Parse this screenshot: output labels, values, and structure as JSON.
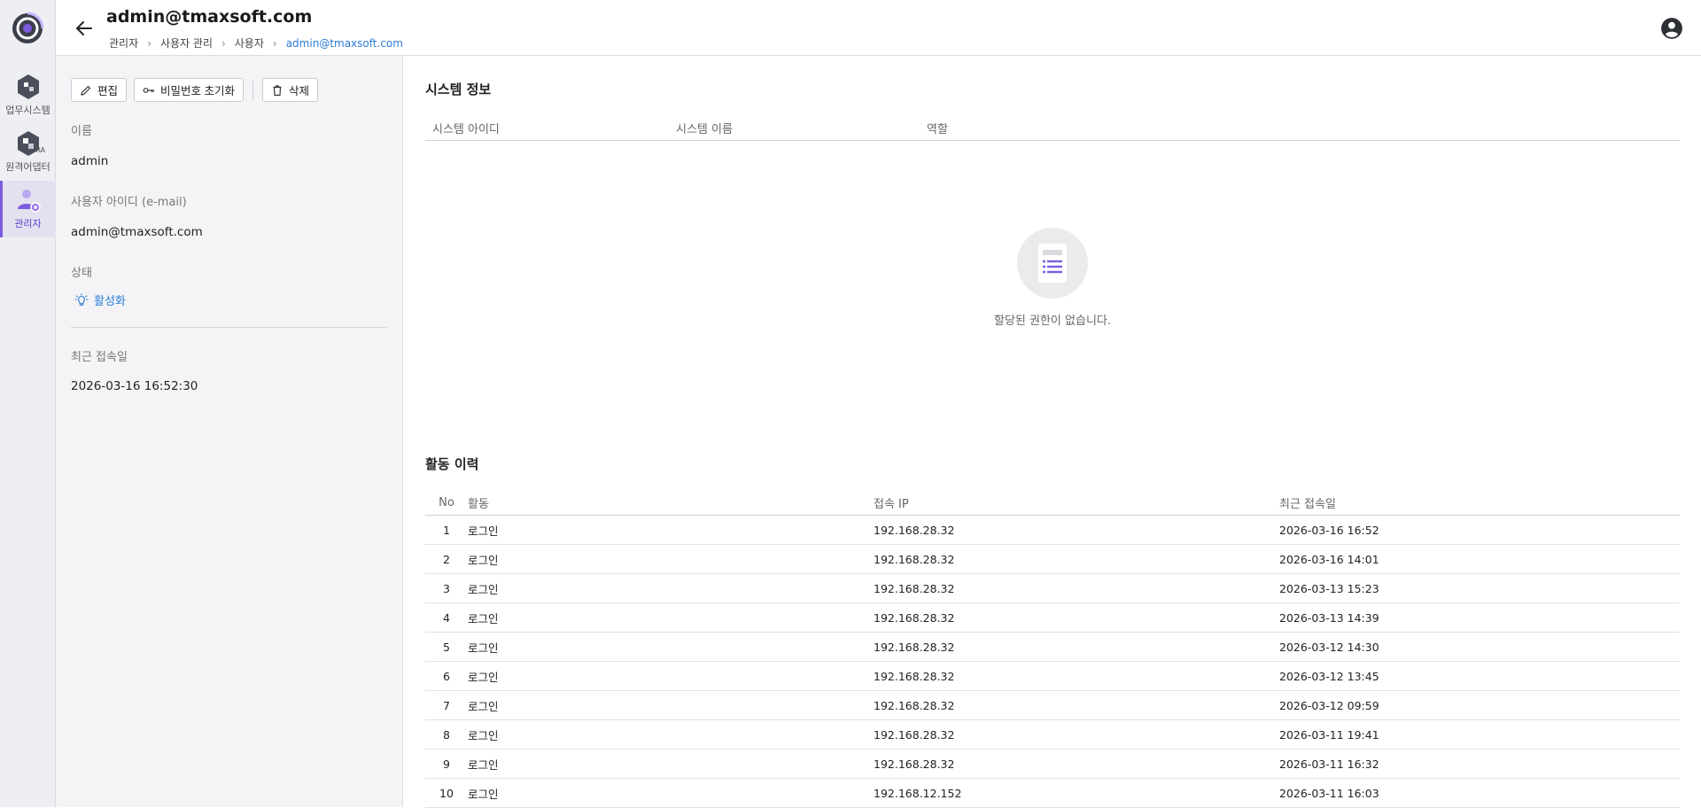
{
  "nav": {
    "items": [
      {
        "label": "업무시스템"
      },
      {
        "label": "원격어댑터",
        "badge": "RA"
      },
      {
        "label": "관리자"
      }
    ]
  },
  "header": {
    "title": "admin@tmaxsoft.com",
    "breadcrumb": [
      "관리자",
      "사용자 관리",
      "사용자",
      "admin@tmaxsoft.com"
    ]
  },
  "toolbar": {
    "edit_label": "편집",
    "reset_password_label": "비밀번호 초기화",
    "delete_label": "삭제"
  },
  "profile": {
    "name_label": "이름",
    "name_value": "admin",
    "id_label": "사용자 아이디 (e-mail)",
    "id_value": "admin@tmaxsoft.com",
    "status_label": "상태",
    "status_value": "활성화",
    "last_login_label": "최근 접속일",
    "last_login_value": "2026-03-16 16:52:30"
  },
  "system_info": {
    "title": "시스템 정보",
    "columns": [
      "시스템 아이디",
      "시스템 이름",
      "역할"
    ],
    "empty_text": "할당된 권한이 없습니다."
  },
  "activity": {
    "title": "활동 이력",
    "columns": [
      "No",
      "활동",
      "접속 IP",
      "최근 접속일"
    ],
    "rows": [
      {
        "no": "1",
        "activity": "로그인",
        "ip": "192.168.28.32",
        "date": "2026-03-16 16:52"
      },
      {
        "no": "2",
        "activity": "로그인",
        "ip": "192.168.28.32",
        "date": "2026-03-16 14:01"
      },
      {
        "no": "3",
        "activity": "로그인",
        "ip": "192.168.28.32",
        "date": "2026-03-13 15:23"
      },
      {
        "no": "4",
        "activity": "로그인",
        "ip": "192.168.28.32",
        "date": "2026-03-13 14:39"
      },
      {
        "no": "5",
        "activity": "로그인",
        "ip": "192.168.28.32",
        "date": "2026-03-12 14:30"
      },
      {
        "no": "6",
        "activity": "로그인",
        "ip": "192.168.28.32",
        "date": "2026-03-12 13:45"
      },
      {
        "no": "7",
        "activity": "로그인",
        "ip": "192.168.28.32",
        "date": "2026-03-12 09:59"
      },
      {
        "no": "8",
        "activity": "로그인",
        "ip": "192.168.28.32",
        "date": "2026-03-11 19:41"
      },
      {
        "no": "9",
        "activity": "로그인",
        "ip": "192.168.28.32",
        "date": "2026-03-11 16:32"
      },
      {
        "no": "10",
        "activity": "로그인",
        "ip": "192.168.12.152",
        "date": "2026-03-11 16:03"
      }
    ]
  },
  "icons": {
    "logo": "app-logo-icon",
    "back": "arrow-left-icon",
    "account": "account-circle-icon",
    "edit": "pencil-icon",
    "reset_password": "key-icon",
    "delete": "trash-icon",
    "status": "lightbulb-icon",
    "empty": "document-list-icon"
  },
  "colors": {
    "accent": "#7b5ce0",
    "link": "#2a7bd6",
    "rail_bg": "#eeeff2",
    "panel_bg": "#f4f4f6"
  }
}
